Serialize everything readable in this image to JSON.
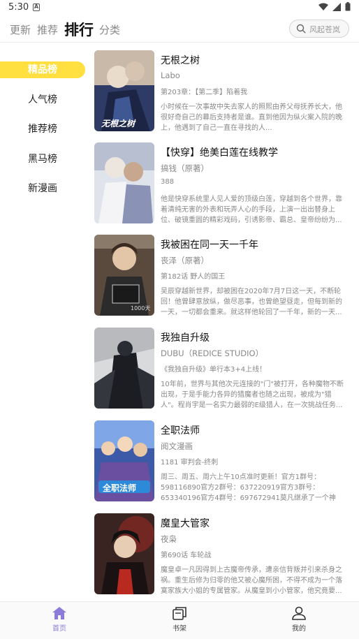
{
  "status_bar": {
    "time": "5:30",
    "app_badge": "A"
  },
  "top_nav": {
    "tabs": [
      {
        "label": "更新"
      },
      {
        "label": "推荐"
      },
      {
        "label": "排行"
      },
      {
        "label": "分类"
      }
    ],
    "active_tab": "排行",
    "search_placeholder": "风起苍岚"
  },
  "sidebar": {
    "items": [
      {
        "label": "精品榜"
      },
      {
        "label": "人气榜"
      },
      {
        "label": "推荐榜"
      },
      {
        "label": "黑马榜"
      },
      {
        "label": "新漫画"
      }
    ],
    "active_item": "精品榜"
  },
  "list": [
    {
      "title": "无根之树",
      "author": "Labo",
      "chapter": "第203章：【第二季】陷着我",
      "desc": "小时候在一次事故中失去家人的照熙由养父母抚养长大，他很好奇自己的幕后支持者是谁。直到他因为纵火案入院的晚上，他遇到了自己一直在寻找的人...",
      "cover_text": "无根之树",
      "accent": "#3a4a7a"
    },
    {
      "title": "【快穿】绝美白莲在线教学",
      "author": "搞钱（原著）",
      "chapter": "388",
      "desc": "他是快穿系统里人见人爱的顶级白莲，穿越到各个世界，靠着清纯无害的外表和玩弄人心的手段，上演一出出替身上位、破镜重圆的精彩戏码，引诱影帝、霸总、皇帝纷纷为...",
      "cover_text": "",
      "accent": "#c8ccd8"
    },
    {
      "title": "我被困在同一天一千年",
      "author": "丧泽（原著）",
      "chapter": "第182话 野人的国王",
      "desc": "吴辰穿越新世界，却被困在2020年7月7日这一天，不断轮回！他曾肆意放纵，做尽恶事，也曾绝望昼走，但每到新的一天，一切都会重来。就这样他轮回了一千年，新的一天...",
      "cover_text": "1000天",
      "accent": "#4a3a30"
    },
    {
      "title": "我独自升级",
      "author": "DUBU（REDICE STUDIO）",
      "chapter": "《我独自升级》单行本3+4上线！",
      "desc": "10年前，世界与其他次元连接的\"门\"被打开，各种魔物不断出现，于是手能力各异的猎魔者也随之出现，被成为\"猎人\"。程肖宇是一名实力最弱的E级猎人，在一次挑战任务...",
      "cover_text": "",
      "accent": "#2a2e36"
    },
    {
      "title": "全职法师",
      "author": "阅文漫画",
      "chapter": "1181 审判会-终刺",
      "desc": "周三、周五、周六上午10点准时更新！官方1群号：598116890官方2群号：637220919官方3群号：653340196官方4群号：697672941莫凡继承了一个神奇...",
      "cover_text": "全职法师",
      "accent": "#5a7ac8"
    },
    {
      "title": "魔皇大管家",
      "author": "夜枭",
      "chapter": "第690话 车轮战",
      "desc": "魔皇卓一凡因得到上古魔帝传承，遭亲信背叛并引来杀身之祸。重生后修为归零的他又被心魔所困，不得不成为一个落寞家族大小姐的专属管家。从魔皇到小小管家，他究竟要...",
      "cover_text": "",
      "accent": "#3a2a2a"
    }
  ],
  "bottom_nav": {
    "items": [
      {
        "label": "首页",
        "icon": "home-icon"
      },
      {
        "label": "书架",
        "icon": "bookshelf-icon"
      },
      {
        "label": "我的",
        "icon": "profile-icon"
      }
    ],
    "active_item": "首页",
    "active_color": "#8c7bd8"
  },
  "colors": {
    "sidebar_active": "#ffe040",
    "tab_active": "#111111",
    "tab_inactive": "#888888"
  }
}
